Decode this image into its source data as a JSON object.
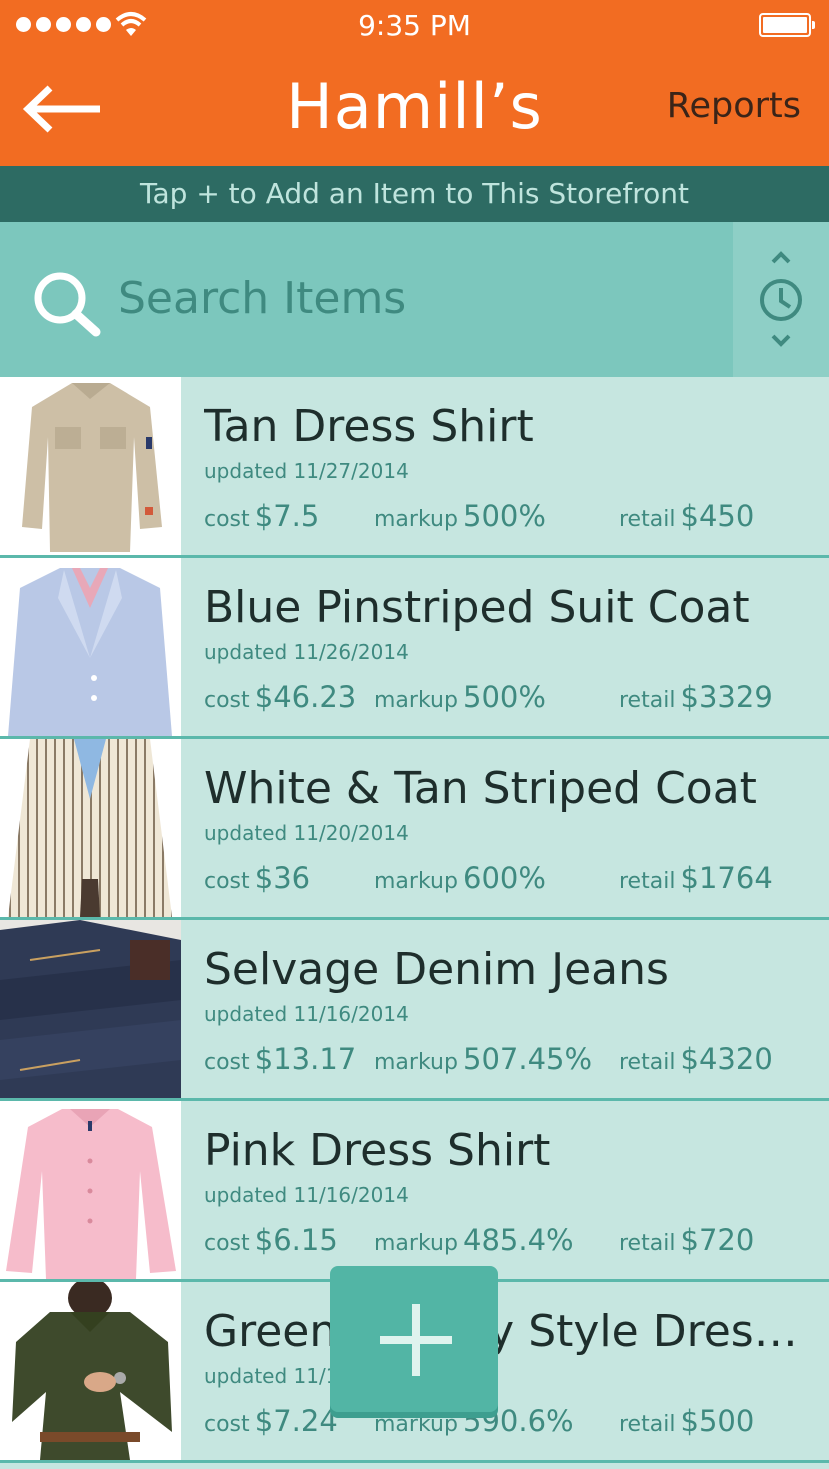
{
  "status_bar": {
    "time": "9:35 PM"
  },
  "header": {
    "title": "Hamill’s",
    "back_icon": "arrow-left-icon",
    "reports_label": "Reports"
  },
  "banner": {
    "text": "Tap + to Add an Item to This Storefront"
  },
  "search": {
    "placeholder": "Search Items",
    "icon": "search-icon",
    "sort_icon": "clock-sort-icon"
  },
  "labels": {
    "cost": "cost",
    "markup": "markup",
    "retail": "retail"
  },
  "items": [
    {
      "name": "Tan Dress Shirt",
      "updated": "updated 11/27/2014",
      "cost": "$7.5",
      "markup": "500%",
      "retail": "$450"
    },
    {
      "name": "Blue Pinstriped Suit Coat",
      "updated": "updated 11/26/2014",
      "cost": "$46.23",
      "markup": "500%",
      "retail": "$3329"
    },
    {
      "name": "White & Tan Striped Coat",
      "updated": "updated 11/20/2014",
      "cost": "$36",
      "markup": "600%",
      "retail": "$1764"
    },
    {
      "name": "Selvage Denim Jeans",
      "updated": "updated 11/16/2014",
      "cost": "$13.17",
      "markup": "507.45%",
      "retail": "$4320"
    },
    {
      "name": "Pink Dress Shirt",
      "updated": "updated 11/16/2014",
      "cost": "$6.15",
      "markup": "485.4%",
      "retail": "$720"
    },
    {
      "name": "Green Military Style Dress...",
      "updated": "updated 11/16/2014",
      "cost": "$7.24",
      "markup": "590.6%",
      "retail": "$500"
    }
  ],
  "colors": {
    "header": "#f26c22",
    "banner": "#2d6b63",
    "search": "#7cc7bd",
    "row": "#c6e6e0",
    "accent": "#52b5a5"
  }
}
